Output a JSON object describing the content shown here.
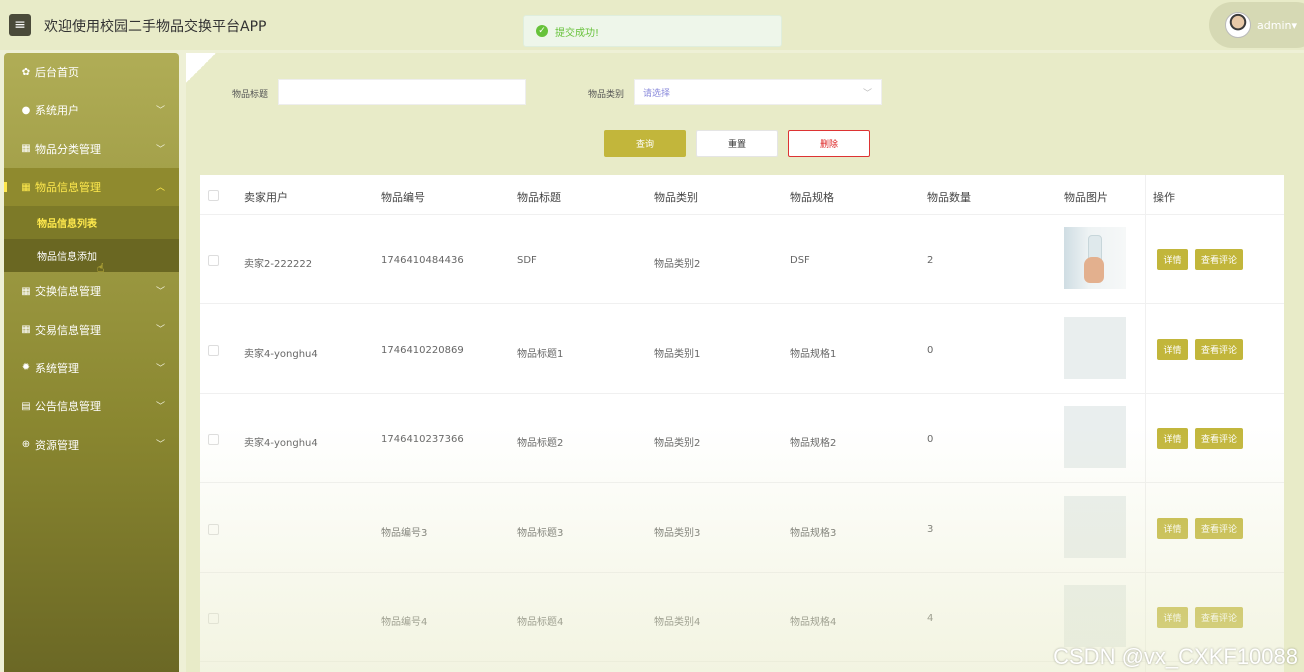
{
  "header": {
    "menu_icon": "hamburger-icon",
    "title": "欢迎使用校园二手物品交换平台APP",
    "user_name": "admin",
    "user_caret": "▾"
  },
  "toast": {
    "icon": "check-circle-icon",
    "message": "提交成功!"
  },
  "sidebar": {
    "items": [
      {
        "label": "后台首页",
        "icon": "home-icon"
      },
      {
        "label": "系统用户",
        "icon": "user-icon"
      },
      {
        "label": "物品分类管理",
        "icon": "grid-icon"
      },
      {
        "label": "物品信息管理",
        "icon": "grid-icon"
      },
      {
        "label": "交换信息管理",
        "icon": "grid-icon"
      },
      {
        "label": "交易信息管理",
        "icon": "grid-icon"
      },
      {
        "label": "系统管理",
        "icon": "gear-icon"
      },
      {
        "label": "公告信息管理",
        "icon": "document-icon"
      },
      {
        "label": "资源管理",
        "icon": "plus-circle-icon"
      }
    ],
    "sub_items": [
      "物品信息列表",
      "物品信息添加"
    ]
  },
  "filters": {
    "title_label": "物品标题",
    "title_value": "",
    "category_label": "物品类别",
    "category_placeholder": "请选择"
  },
  "buttons": {
    "query": "查询",
    "reset": "重置",
    "delete": "删除"
  },
  "table": {
    "columns": [
      "卖家用户",
      "物品编号",
      "物品标题",
      "物品类别",
      "物品规格",
      "物品数量",
      "物品图片",
      "操作"
    ],
    "rows": [
      {
        "seller": "卖家2-222222",
        "code": "1746410484436",
        "title": "SDF",
        "category": "物品类别2",
        "spec": "DSF",
        "qty": "2"
      },
      {
        "seller": "卖家4-yonghu4",
        "code": "1746410220869",
        "title": "物品标题1",
        "category": "物品类别1",
        "spec": "物品规格1",
        "qty": "0"
      },
      {
        "seller": "卖家4-yonghu4",
        "code": "1746410237366",
        "title": "物品标题2",
        "category": "物品类别2",
        "spec": "物品规格2",
        "qty": "0"
      },
      {
        "seller": "",
        "code": "物品编号3",
        "title": "物品标题3",
        "category": "物品类别3",
        "spec": "物品规格3",
        "qty": "3"
      },
      {
        "seller": "",
        "code": "物品编号4",
        "title": "物品标题4",
        "category": "物品类别4",
        "spec": "物品规格4",
        "qty": "4"
      }
    ],
    "detail_label": "详情",
    "comments_label": "查看评论"
  },
  "watermark": "CSDN @vx_CXKF10088",
  "colors": {
    "accent": "#c2b63b",
    "sidebar": "#8a8730",
    "active_text": "#ffe94d",
    "delete": "#dd2222"
  }
}
